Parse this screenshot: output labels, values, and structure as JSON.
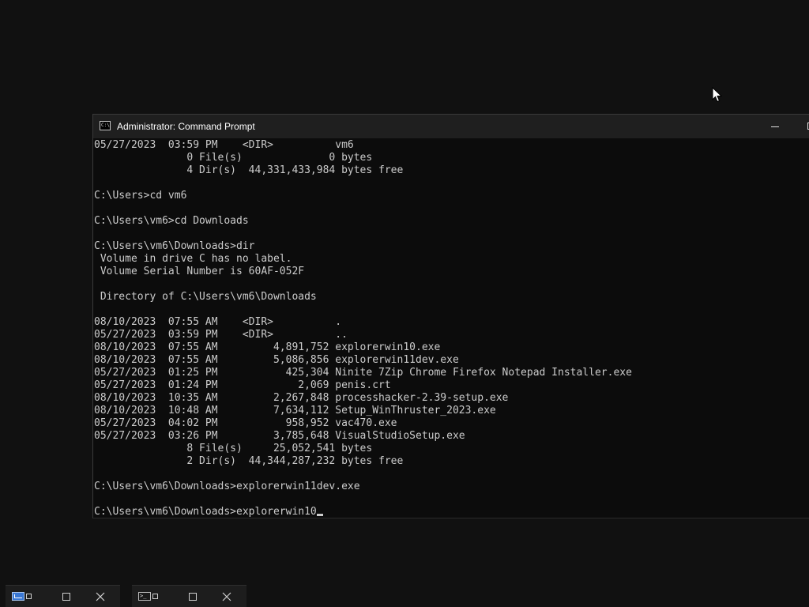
{
  "window": {
    "title": "Administrator: Command Prompt",
    "app_icon": "cmd-icon",
    "controls": [
      "minimize-icon",
      "maximize-icon"
    ]
  },
  "console": {
    "lines": [
      "05/27/2023  03:59 PM    <DIR>          vm6",
      "               0 File(s)              0 bytes",
      "               4 Dir(s)  44,331,433,984 bytes free",
      "",
      "C:\\Users>cd vm6",
      "",
      "C:\\Users\\vm6>cd Downloads",
      "",
      "C:\\Users\\vm6\\Downloads>dir",
      " Volume in drive C has no label.",
      " Volume Serial Number is 60AF-052F",
      "",
      " Directory of C:\\Users\\vm6\\Downloads",
      "",
      "08/10/2023  07:55 AM    <DIR>          .",
      "05/27/2023  03:59 PM    <DIR>          ..",
      "08/10/2023  07:55 AM         4,891,752 explorerwin10.exe",
      "08/10/2023  07:55 AM         5,086,856 explorerwin11dev.exe",
      "05/27/2023  01:25 PM           425,304 Ninite 7Zip Chrome Firefox Notepad Installer.exe",
      "05/27/2023  01:24 PM             2,069 penis.crt",
      "08/10/2023  10:35 AM         2,267,848 processhacker-2.39-setup.exe",
      "08/10/2023  10:48 AM         7,634,112 Setup_WinThruster_2023.exe",
      "05/27/2023  04:02 PM           958,952 vac470.exe",
      "05/27/2023  03:26 PM         3,785,648 VisualStudioSetup.exe",
      "               8 File(s)     25,052,541 bytes",
      "               2 Dir(s)  44,344,287,232 bytes free",
      "",
      "C:\\Users\\vm6\\Downloads>explorerwin11dev.exe",
      "",
      "C:\\Users\\vm6\\Downloads>explorerwin10"
    ]
  },
  "cursor": {
    "icon": "mouse-pointer-icon"
  },
  "taskbar_thumbnails": [
    {
      "app_icon": "task-manager-icon"
    },
    {
      "app_icon": "terminal-icon"
    }
  ],
  "colors": {
    "desktop_background": "#111111",
    "console_background": "#0c0c0c",
    "console_text": "#cccccc",
    "titlebar_background": "#1f1f1f"
  }
}
